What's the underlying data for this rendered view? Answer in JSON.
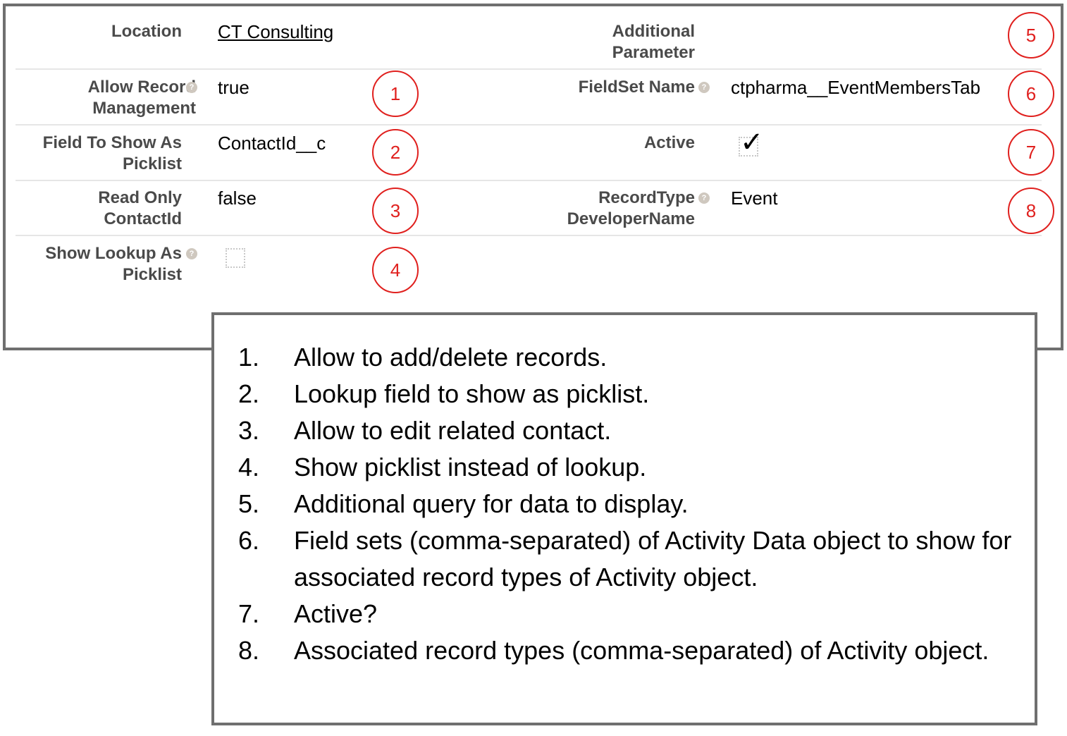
{
  "fields": {
    "location": {
      "label": "Location",
      "value": "CT Consulting"
    },
    "allow_record_management": {
      "label": "Allow Record Management",
      "value": "true"
    },
    "field_to_show_as_picklist": {
      "label": "Field To Show As Picklist",
      "value": "ContactId__c"
    },
    "read_only_contactid": {
      "label": "Read Only ContactId",
      "value": "false"
    },
    "show_lookup_as_picklist": {
      "label": "Show Lookup As Picklist",
      "checked": false
    },
    "additional_parameter": {
      "label": "Additional Parameter",
      "value": ""
    },
    "fieldset_name": {
      "label": "FieldSet Name",
      "value": "ctpharma__EventMembersTab"
    },
    "active": {
      "label": "Active",
      "checked": true
    },
    "recordtype_developername": {
      "label": "RecordType DeveloperName",
      "value": "Event"
    }
  },
  "markers": [
    "1",
    "2",
    "3",
    "4",
    "5",
    "6",
    "7",
    "8"
  ],
  "notes": [
    {
      "num": "1.",
      "text": "Allow to add/delete records."
    },
    {
      "num": "2.",
      "text": "Lookup field to show as picklist."
    },
    {
      "num": "3.",
      "text": "Allow to edit related contact."
    },
    {
      "num": "4.",
      "text": "Show picklist instead of lookup."
    },
    {
      "num": "5.",
      "text": "Additional query for data to display."
    },
    {
      "num": "6.",
      "text": "Field sets (comma-separated) of Activity Data object to show for associated record types of Activity object."
    },
    {
      "num": "7.",
      "text": "Active?"
    },
    {
      "num": "8.",
      "text": "Associated record types (comma-separated) of Activity object."
    }
  ],
  "colors": {
    "marker": "#e0201e",
    "label": "#4a4a4a",
    "border": "#6f6f6f"
  },
  "icons": {
    "help": "help-icon",
    "check": "checkmark-icon"
  }
}
